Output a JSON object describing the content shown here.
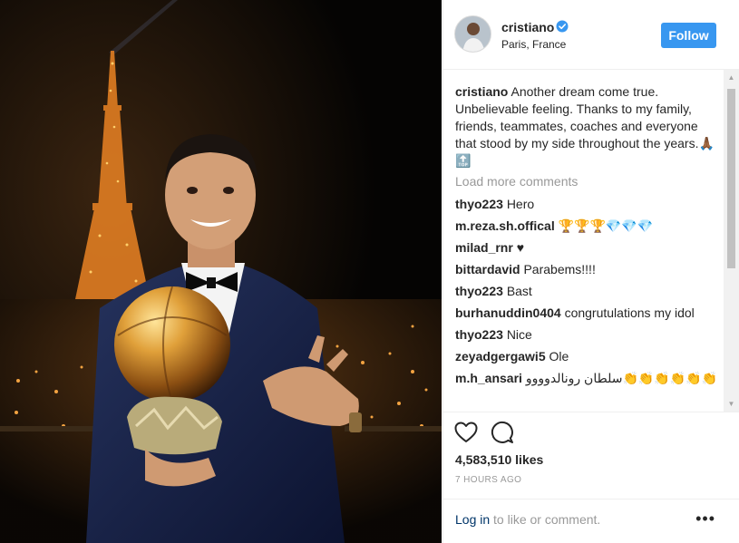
{
  "post": {
    "photo_alt": "",
    "user": {
      "username": "cristiano",
      "location": "Paris, France",
      "follow_label": "Follow",
      "verified_icon": "verified-badge-icon"
    },
    "caption": {
      "username": "cristiano",
      "text": "Another dream come true. Unbelievable feeling. Thanks to my family, friends, teammates, coaches and everyone that stood by my side throughout the years."
    },
    "load_more_label": "Load more comments",
    "comments": [
      {
        "username": "thyo223",
        "text": "Hero"
      },
      {
        "username": "m.reza.sh.offical",
        "text": "🏆🏆🏆💎💎💎"
      },
      {
        "username": "milad_rnr",
        "text": "♥"
      },
      {
        "username": "bittardavid",
        "text": "Parabems!!!!"
      },
      {
        "username": "thyo223",
        "text": "Bast"
      },
      {
        "username": "burhanuddin0404",
        "text": "congrutulations my idol"
      },
      {
        "username": "thyo223",
        "text": "Nice"
      },
      {
        "username": "zeyadgergawi5",
        "text": "Ole"
      },
      {
        "username": "m.h_ansari",
        "text": "سلطان رونالدوووو👏👏👏👏👏👏"
      }
    ],
    "likes": "4,583,510 likes",
    "time_ago": "7 HOURS AGO",
    "footer": {
      "login_label": "Log in",
      "login_suffix": " to like or comment.",
      "more_label": "•••"
    },
    "colors": {
      "follow_button": "#3897f0",
      "link": "#003569",
      "muted": "#999999",
      "text": "#262626"
    },
    "icons": [
      "heart-icon",
      "comment-icon",
      "more-options-icon"
    ]
  }
}
